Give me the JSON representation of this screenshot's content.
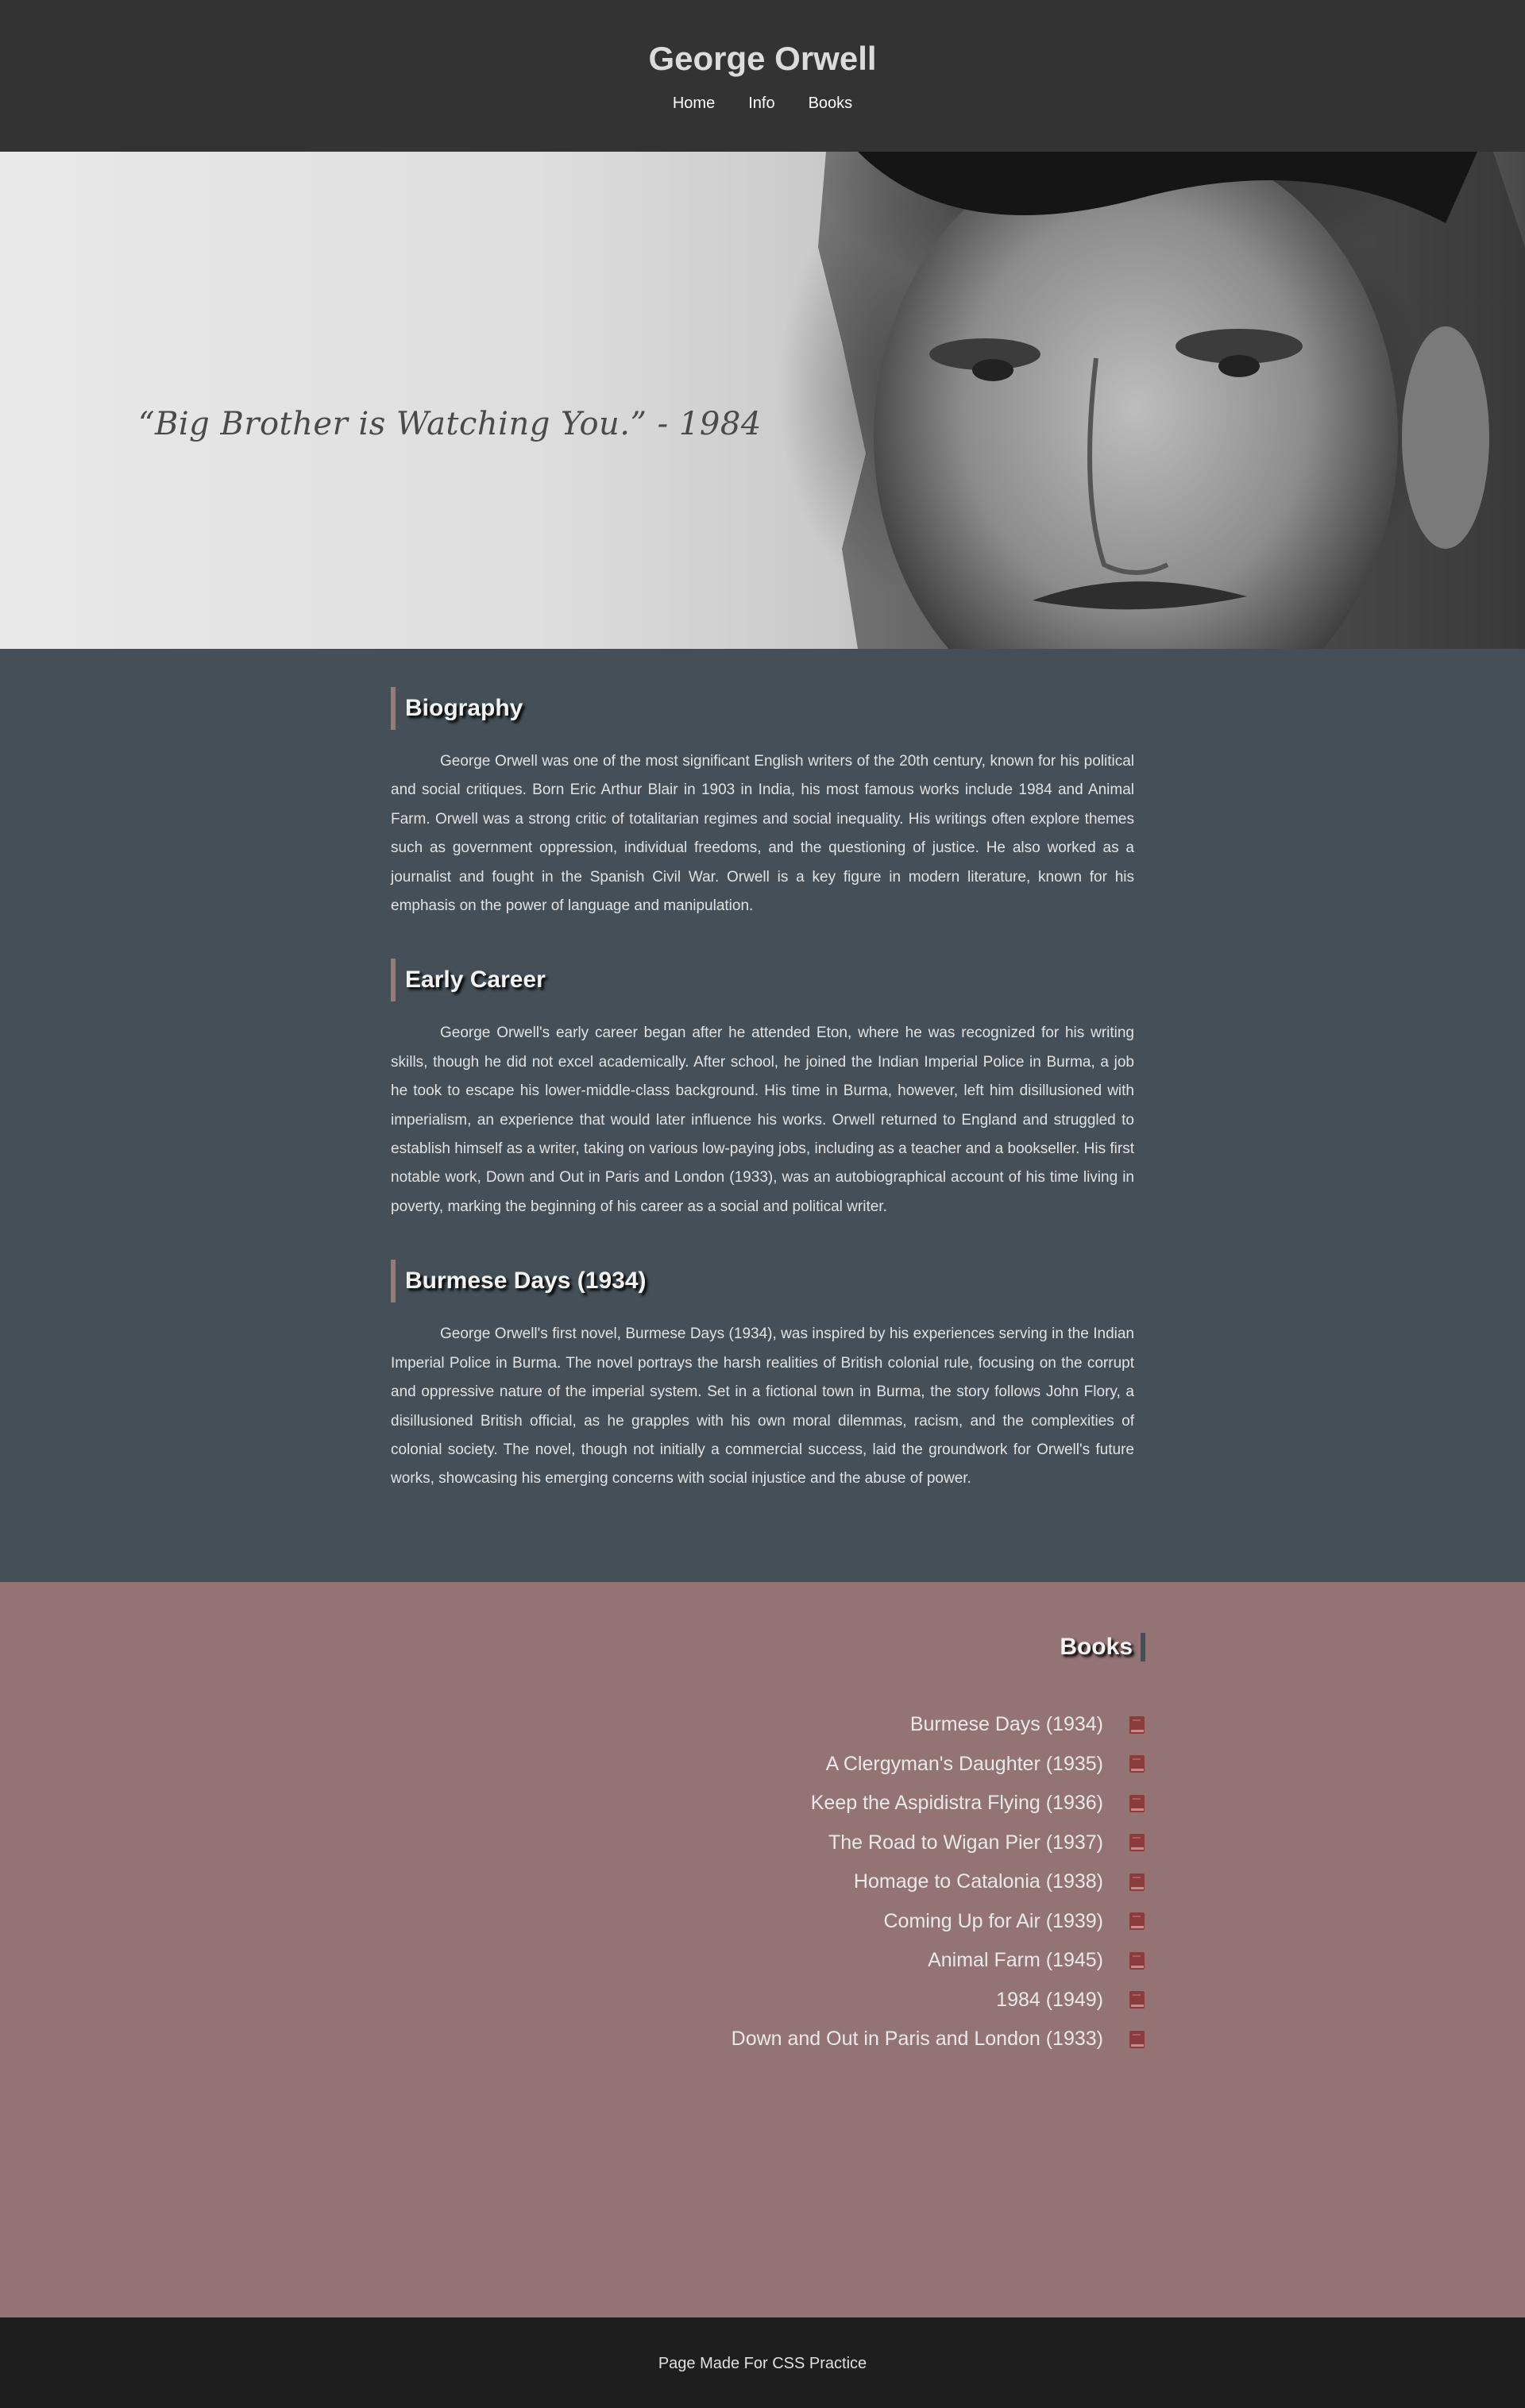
{
  "header": {
    "title": "George Orwell",
    "nav": [
      "Home",
      "Info",
      "Books"
    ]
  },
  "hero": {
    "quote": "“Big Brother is Watching You.” - 1984"
  },
  "sections": [
    {
      "heading": "Biography",
      "text": "George Orwell was one of the most significant English writers of the 20th century, known for his political and social critiques. Born Eric Arthur Blair in 1903 in India, his most famous works include 1984 and Animal Farm. Orwell was a strong critic of totalitarian regimes and social inequality. His writings often explore themes such as government oppression, individual freedoms, and the questioning of justice. He also worked as a journalist and fought in the Spanish Civil War. Orwell is a key figure in modern literature, known for his emphasis on the power of language and manipulation."
    },
    {
      "heading": "Early Career",
      "text": "George Orwell's early career began after he attended Eton, where he was recognized for his writing skills, though he did not excel academically. After school, he joined the Indian Imperial Police in Burma, a job he took to escape his lower-middle-class background. His time in Burma, however, left him disillusioned with imperialism, an experience that would later influence his works. Orwell returned to England and struggled to establish himself as a writer, taking on various low-paying jobs, including as a teacher and a bookseller. His first notable work, Down and Out in Paris and London (1933), was an autobiographical account of his time living in poverty, marking the beginning of his career as a social and political writer."
    },
    {
      "heading": "Burmese Days (1934)",
      "text": "George Orwell's first novel, Burmese Days (1934), was inspired by his experiences serving in the Indian Imperial Police in Burma. The novel portrays the harsh realities of British colonial rule, focusing on the corrupt and oppressive nature of the imperial system. Set in a fictional town in Burma, the story follows John Flory, a disillusioned British official, as he grapples with his own moral dilemmas, racism, and the complexities of colonial society. The novel, though not initially a commercial success, laid the groundwork for Orwell's future works, showcasing his emerging concerns with social injustice and the abuse of power."
    }
  ],
  "books": {
    "heading": "Books",
    "icon": "book-icon",
    "items": [
      "Burmese Days (1934)",
      "A Clergyman's Daughter (1935)",
      "Keep the Aspidistra Flying (1936)",
      "The Road to Wigan Pier (1937)",
      "Homage to Catalonia (1938)",
      "Coming Up for Air (1939)",
      "Animal Farm (1945)",
      "1984 (1949)",
      "Down and Out in Paris and London (1933)"
    ]
  },
  "footer": {
    "text": "Page Made For CSS Practice"
  },
  "colors": {
    "header_bg": "#333333",
    "content_bg": "#444f58",
    "books_bg": "#937373",
    "footer_bg": "#1e1e1e",
    "accent": "#967b7b",
    "book_icon": "#8b3d3d"
  }
}
